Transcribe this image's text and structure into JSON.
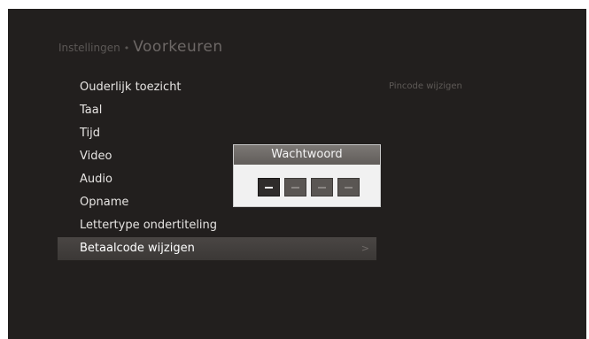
{
  "breadcrumb": {
    "parent": "Instellingen",
    "separator": "•",
    "current": "Voorkeuren"
  },
  "menu": {
    "items": [
      {
        "label": "Ouderlijk toezicht"
      },
      {
        "label": "Taal"
      },
      {
        "label": "Tijd"
      },
      {
        "label": "Video"
      },
      {
        "label": "Audio"
      },
      {
        "label": "Opname"
      },
      {
        "label": "Lettertype ondertiteling"
      },
      {
        "label": "Betaalcode wijzigen",
        "selected": true
      }
    ],
    "chevron": ">"
  },
  "submenu_hint": "Pincode wijzigen",
  "password_dialog": {
    "title": "Wachtwoord",
    "digits": [
      "",
      "",
      "",
      ""
    ],
    "active_index": 0
  },
  "colors": {
    "background": "#221f1e",
    "highlight": "#444140",
    "dialog_header": "#6e6a67",
    "dialog_body": "#f1f1f1"
  }
}
